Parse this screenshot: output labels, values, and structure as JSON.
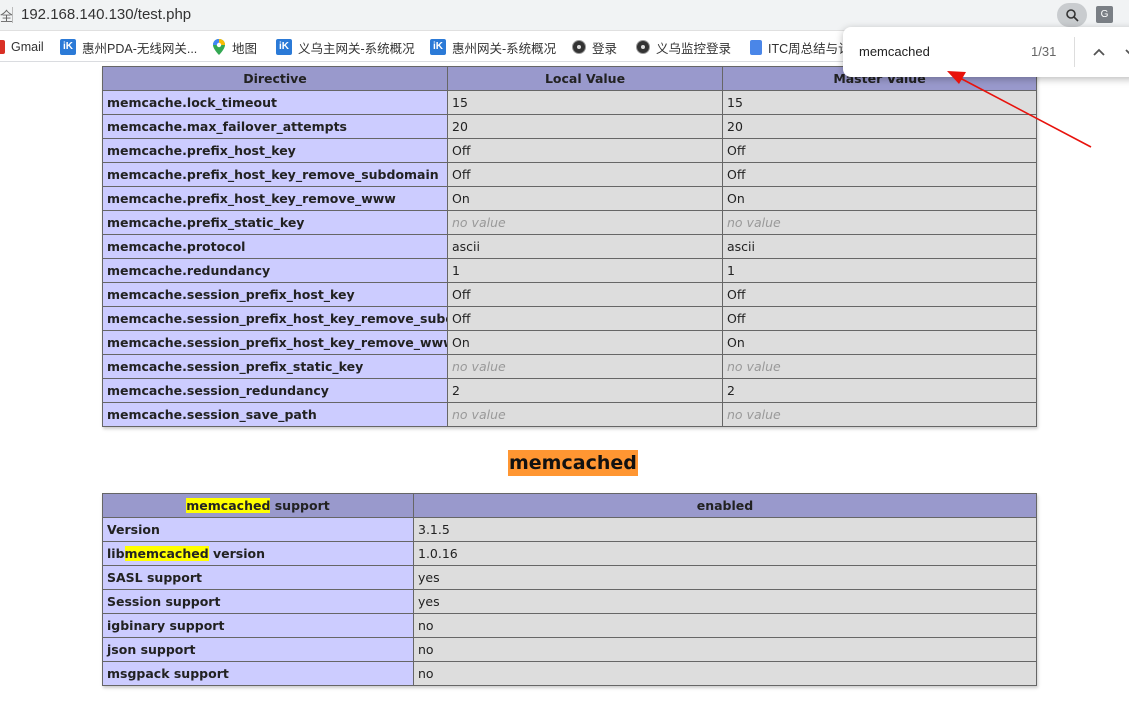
{
  "browser": {
    "lock_fragment": "全",
    "url": "192.168.140.130/test.php",
    "translate_glyph": "G",
    "bookmarks": [
      {
        "label": "Gmail",
        "icon": "gmail-icon"
      },
      {
        "label": "惠州PDA-无线网关...",
        "icon": "ik-icon"
      },
      {
        "label": "地图",
        "icon": "map-pin-icon"
      },
      {
        "label": "义乌主网关-系统概况",
        "icon": "ik-icon"
      },
      {
        "label": "惠州网关-系统概况",
        "icon": "ik-icon"
      },
      {
        "label": "登录",
        "icon": "camera-icon"
      },
      {
        "label": "义乌监控登录",
        "icon": "camera-icon"
      },
      {
        "label": "ITC周总结与计",
        "icon": "doc-icon"
      }
    ]
  },
  "find_bar": {
    "query": "memcached",
    "count": "1/31"
  },
  "memcache_table": {
    "headers": [
      "Directive",
      "Local Value",
      "Master Value"
    ],
    "rows": [
      {
        "directive": "memcache.lock_timeout",
        "local": "15",
        "master": "15"
      },
      {
        "directive": "memcache.max_failover_attempts",
        "local": "20",
        "master": "20"
      },
      {
        "directive": "memcache.prefix_host_key",
        "local": "Off",
        "master": "Off"
      },
      {
        "directive": "memcache.prefix_host_key_remove_subdomain",
        "local": "Off",
        "master": "Off"
      },
      {
        "directive": "memcache.prefix_host_key_remove_www",
        "local": "On",
        "master": "On"
      },
      {
        "directive": "memcache.prefix_static_key",
        "local": "no value",
        "master": "no value"
      },
      {
        "directive": "memcache.protocol",
        "local": "ascii",
        "master": "ascii"
      },
      {
        "directive": "memcache.redundancy",
        "local": "1",
        "master": "1"
      },
      {
        "directive": "memcache.session_prefix_host_key",
        "local": "Off",
        "master": "Off"
      },
      {
        "directive": "memcache.session_prefix_host_key_remove_subdomain",
        "local": "Off",
        "master": "Off"
      },
      {
        "directive": "memcache.session_prefix_host_key_remove_www",
        "local": "On",
        "master": "On"
      },
      {
        "directive": "memcache.session_prefix_static_key",
        "local": "no value",
        "master": "no value"
      },
      {
        "directive": "memcache.session_redundancy",
        "local": "2",
        "master": "2"
      },
      {
        "directive": "memcache.session_save_path",
        "local": "no value",
        "master": "no value"
      }
    ]
  },
  "memcached_section": {
    "heading": "memcached",
    "header_left_highlight": "memcached",
    "header_left_rest": " support",
    "header_right": "enabled",
    "rows": [
      {
        "label": "Version",
        "value": "3.1.5"
      },
      {
        "label_prefix": "lib",
        "label_highlight": "memcached",
        "label_suffix": " version",
        "value": "1.0.16"
      },
      {
        "label": "SASL support",
        "value": "yes"
      },
      {
        "label": "Session support",
        "value": "yes"
      },
      {
        "label": "igbinary support",
        "value": "no"
      },
      {
        "label": "json support",
        "value": "no"
      },
      {
        "label": "msgpack support",
        "value": "no"
      }
    ]
  },
  "colors": {
    "header": "#9999cc",
    "label_cell": "#ccccff",
    "value_cell": "#dddddd",
    "find_highlight": "#ffff00",
    "active_match": "#ff9632",
    "annotation_arrow": "#e8120c"
  }
}
